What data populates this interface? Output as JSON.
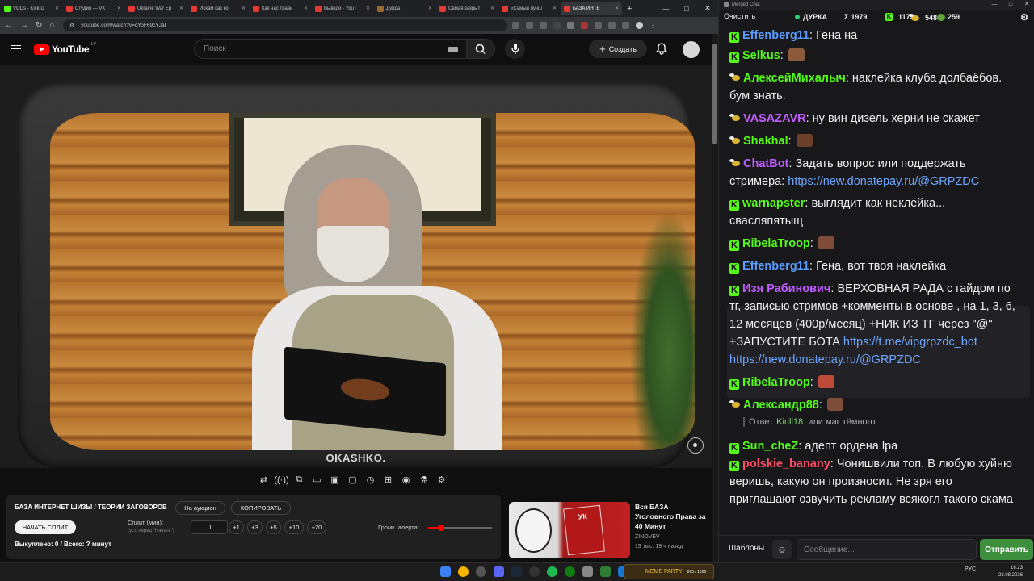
{
  "browser": {
    "tabs": [
      {
        "label": "VODs - Kick D",
        "color": "#53fc18"
      },
      {
        "label": "Студия — VK",
        "color": "#e53935"
      },
      {
        "label": "Ukraine War Ep",
        "color": "#e53935"
      },
      {
        "label": "Искам как ко",
        "color": "#e53935"
      },
      {
        "label": "Как нас трави",
        "color": "#e53935"
      },
      {
        "label": "Выведи - YouT",
        "color": "#e53935"
      },
      {
        "label": "Дурра",
        "color": "#9c6b30"
      },
      {
        "label": "Самая закрыт",
        "color": "#e53935"
      },
      {
        "label": "«Самый лучш",
        "color": "#e53935"
      },
      {
        "label": "БАЗА ИНТЕ",
        "color": "#e53935"
      }
    ],
    "url": "youtube.com/watch?v=qYoF69cYJaI",
    "new_tab": "+",
    "window_controls": [
      "—",
      "□",
      "✕"
    ]
  },
  "youtube": {
    "logo_text": "YouTube",
    "country": "LV",
    "search_placeholder": "Поиск",
    "create_label": "Создать",
    "video_watermark": "OKASHKO.",
    "controls": [
      "⇄",
      "((·))",
      "⧉",
      "▭",
      "▣",
      "▢",
      "◷",
      "⊞",
      "◉",
      "⚗",
      "⚙"
    ]
  },
  "panel": {
    "title": "БАЗА ИНТЕРНЕТ ШИЗЫ / ТЕОРИИ ЗАГОВОРОВ",
    "auction_label": "На аукцион",
    "copy_label": "КОПИРОВАТЬ",
    "start_label": "НАЧАТЬ СПЛИТ",
    "split_label": "Сплит (мин):",
    "split_hint": "(уст. перед \"Начать\")",
    "split_value": "0",
    "increments": [
      "+1",
      "+3",
      "+5",
      "+10",
      "+20"
    ],
    "alert_label": "Громк. алерта:",
    "alert_volume": 0.2,
    "released": "Выкуплено: 0 / Всего: ? минут"
  },
  "recommendation": {
    "title": "Вся БАЗА Уголовного Права за 40 Минут",
    "channel": "ZINOVEV",
    "meta": "19 тыс.  19 ч назад",
    "thumb_text": "УК"
  },
  "chat": {
    "window_title": "Merged Chat",
    "clear_label": "Очистить",
    "live_name": "ДУРКА",
    "stats": [
      {
        "icon": "Σ",
        "value": "1979"
      },
      {
        "icon": "K",
        "value": "1172"
      },
      {
        "icon": "bee",
        "value": "548"
      },
      {
        "icon": "frog",
        "value": "259"
      }
    ],
    "messages": [
      {
        "platform": "kick",
        "user": "Effenberg11",
        "color": "#5b9cff",
        "text": "Гена на"
      },
      {
        "platform": "kick",
        "user": "Selkus",
        "color": "#53fc18",
        "text": ""
      },
      {
        "platform": "bee",
        "user": "АлексейМихалыч",
        "color": "#53fc18",
        "text": "наклейка клуба  долбаёбов. бум знать."
      },
      {
        "platform": "bee",
        "user": "VASAZAVR",
        "color": "#c15cff",
        "text": "ну вин дизель херни не скажет"
      },
      {
        "platform": "bee",
        "user": "Shakhal",
        "color": "#53fc18",
        "text": ""
      },
      {
        "platform": "bee",
        "user": "ChatBot",
        "color": "#c15cff",
        "text": "Задать вопрос или поддержать стримера: ",
        "link": "https://new.donatepay.ru/@GRPZDC"
      },
      {
        "platform": "kick",
        "user": "warnapster",
        "color": "#53fc18",
        "text": "выглядит как неклейка... свасляпятыщ"
      },
      {
        "platform": "kick",
        "user": "RibelaTroop",
        "color": "#53fc18",
        "text": ""
      },
      {
        "platform": "kick",
        "user": "Effenberg11",
        "color": "#5b9cff",
        "text": "Гена, вот твоя наклейка"
      },
      {
        "platform": "kick",
        "user": "Изя Рабинович",
        "color": "#c15cff",
        "text": "ВЕРХОВНАЯ РАДА с гайдом по тг, записью стримов +комменты в основе  , на 1, 3, 6, 12 месяцев (400р/месяц) +НИК ИЗ ТГ через \"@\" +ЗАПУСТИТЕ БОТА ",
        "link": "https://t.me/vipgrpzdc_bot",
        "link2": "https://new.donatepay.ru/@GRPZDC"
      },
      {
        "platform": "kick",
        "user": "RibelaTroop",
        "color": "#53fc18",
        "text": ""
      },
      {
        "platform": "bee",
        "user": "Александр88",
        "color": "#53fc18",
        "text": ""
      },
      {
        "platform": "kick",
        "user": "Sun_cheZ",
        "color": "#53fc18",
        "text": "адепт ордена lpa"
      },
      {
        "platform": "kick",
        "user": "polskie_banany",
        "color": "#ff4d6a",
        "text": "Чонишвили топ. В любую хуйню веришь, какую он произносит. Не зря его приглашают озвучить рекламу всякогл такого скама"
      }
    ],
    "reply": {
      "prefix": "Ответ",
      "user": "Kirill18",
      "text": ": или маг тёмного"
    },
    "templates_label": "Шаблоны",
    "input_placeholder": "Сообщение...",
    "send_label": "Отправить"
  },
  "taskbar": {
    "meme_label": "MEME PARTY",
    "meme_progress": "875 / 1500",
    "lang": "РУС",
    "time": "16:23",
    "date": "28.08.2026"
  }
}
